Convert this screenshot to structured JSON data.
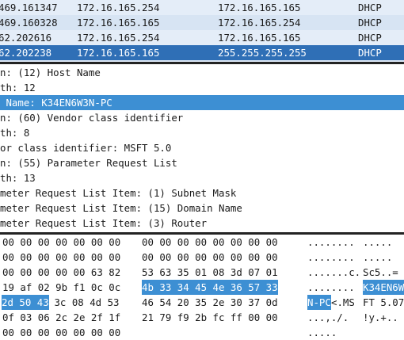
{
  "packets": [
    {
      "time": "469.161347",
      "source": "172.16.165.254",
      "destination": "172.16.165.165",
      "protocol": "DHCP"
    },
    {
      "time": "469.160328",
      "source": "172.16.165.165",
      "destination": "172.16.165.254",
      "protocol": "DHCP"
    },
    {
      "time": "62.202616",
      "source": "172.16.165.254",
      "destination": "172.16.165.165",
      "protocol": "DHCP"
    },
    {
      "time": "62.202238",
      "source": "172.16.165.165",
      "destination": "255.255.255.255",
      "protocol": "DHCP"
    }
  ],
  "details": [
    "n: (12) Host Name",
    "th: 12",
    " Name: K34EN6W3N-PC",
    "n: (60) Vendor class identifier",
    "th: 8",
    "or class identifier: MSFT 5.0",
    "n: (55) Parameter Request List",
    "th: 13",
    "meter Request List Item: (1) Subnet Mask",
    "meter Request List Item: (15) Domain Name",
    "meter Request List Item: (3) Router"
  ],
  "hex": [
    {
      "h1": "00 00 00 00 00 00 00",
      "h2": "00 00 00 00 00 00 00 00",
      "a1": "........",
      "a2": "....."
    },
    {
      "h1": "00 00 00 00 00 00 00",
      "h2": "00 00 00 00 00 00 00 00",
      "a1": "........",
      "a2": "....."
    },
    {
      "h1": "00 00 00 00 00 63 82",
      "h2": "53 63 35 01 08 3d 07 01",
      "a1": ".......c.",
      "a2": "Sc5..="
    },
    {
      "h1": "19 af 02 9b f1 0c 0c",
      "h2": "4b 33 34 45 4e 36 57 33",
      "a1": "........",
      "a2": "K34EN6W"
    },
    {
      "h1": "2d 50 43",
      "h1b": " 3c 08 4d 53",
      "h2": "46 54 20 35 2e 30 37 0d",
      "a1": "N-PC",
      "a1b": "<.MS",
      "a2": "FT 5.07"
    },
    {
      "h1": "0f 03 06 2c 2e 2f 1f",
      "h2": "21 79 f9 2b fc ff 00 00",
      "a1": "...,./.",
      "a2": "!y.+.."
    },
    {
      "h1": "00 00 00 00 00 00 00",
      "h2": "",
      "a1": ".....",
      "a2": ""
    }
  ]
}
